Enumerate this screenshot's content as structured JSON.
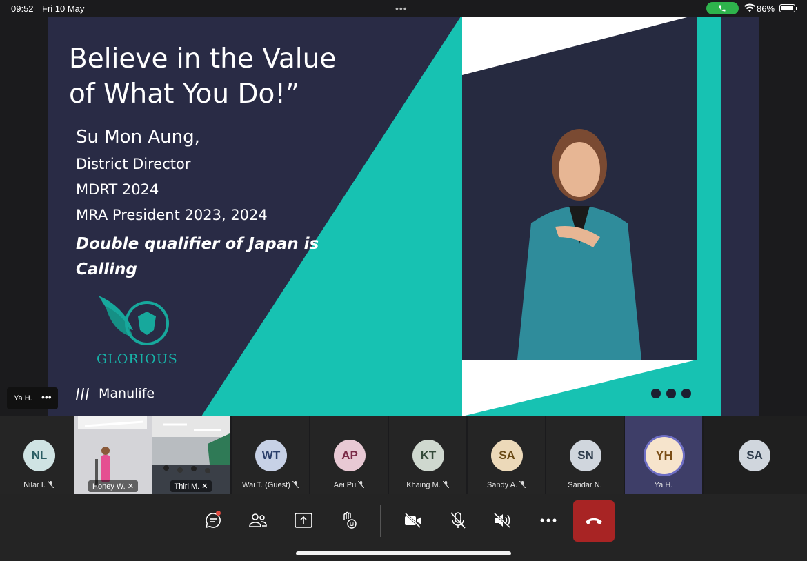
{
  "status_bar": {
    "time": "09:52",
    "date": "Fri 10 May",
    "battery": "86%",
    "call_pill_color": "#2eb34c"
  },
  "slide": {
    "title_line1": "Believe in the Value",
    "title_line2": "of What You Do!”",
    "speaker_name": "Su Mon Aung,",
    "speaker_role": "District Director",
    "speaker_mdrt": "MDRT 2024",
    "speaker_mra": "MRA President 2023, 2024",
    "highlight": "Double qualifier of Japan is Calling",
    "logo_text": "GLORIOUS",
    "brand": "Manulife",
    "accent_color": "#17c2b2"
  },
  "presenter": {
    "name": "Ya H."
  },
  "participants": [
    {
      "initials": "NL",
      "label": "Nilar I.",
      "muted": true,
      "bg": "#cfe3e3",
      "fg": "#2a5d63"
    },
    {
      "video": true,
      "label": "Honey W.",
      "muted": true
    },
    {
      "video": true,
      "label": "Thiri M.",
      "muted": true
    },
    {
      "initials": "WT",
      "label": "Wai T. (Guest)",
      "muted": true,
      "bg": "#c7d1e6",
      "fg": "#2b3f6b"
    },
    {
      "initials": "AP",
      "label": "Aei Pu",
      "muted": true,
      "bg": "#e8c9d4",
      "fg": "#7a2a47"
    },
    {
      "initials": "KT",
      "label": "Khaing M.",
      "muted": true,
      "bg": "#cfd8cf",
      "fg": "#344a3a"
    },
    {
      "initials": "SA",
      "label": "Sandy A.",
      "muted": true,
      "bg": "#ecd9b9",
      "fg": "#6a4a16"
    },
    {
      "initials": "SN",
      "label": "Sandar N.",
      "muted": false,
      "bg": "#d0d6dd",
      "fg": "#2e3c4c"
    },
    {
      "initials": "YH",
      "label": "Ya H.",
      "muted": false,
      "bg": "#f6e4cc",
      "fg": "#7a4d16",
      "active": true
    },
    {
      "initials": "SA",
      "label": "",
      "muted": false,
      "bg": "#d0d6dd",
      "fg": "#2e3c4c"
    }
  ],
  "controls": [
    "chat-icon",
    "people-icon",
    "share-icon",
    "react-icon",
    "camera-off-icon",
    "mic-off-icon",
    "speaker-off-icon",
    "more-icon",
    "hangup-icon"
  ]
}
